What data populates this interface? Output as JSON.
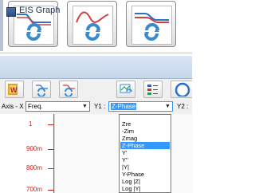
{
  "window": {
    "title": "EIS Graph"
  },
  "axis_bar": {
    "x_label": "Axis - X",
    "x_value": "Freq.",
    "y1_label": "Y1 :",
    "y1_value": "Z-Phase",
    "y2_label": "Y2 :"
  },
  "dropdown": {
    "options": [
      "Zre",
      "-Zim",
      "Zmag",
      "Z-Phase",
      "Y'",
      "Y''",
      "|Y|",
      "Y-Phase",
      "Log |Z|",
      "Log |Y|"
    ],
    "selected": "Z-Phase"
  },
  "plot": {
    "y_ticks": [
      "1",
      "900m",
      "800m",
      "700m"
    ]
  },
  "colors": {
    "accent": "#3399ff",
    "tick": "#d02020",
    "titlebar": "#c6d6ea"
  },
  "icons": {
    "big_buttons": [
      "freq-phase-graph-icon",
      "freq-sine-graph-icon",
      "freq-dual-line-graph-icon"
    ],
    "toolbar": [
      "word-export-icon",
      "graph-refresh-icon",
      "graph-refresh-icon",
      "graph-add-icon",
      "legend-icon",
      "globe-icon"
    ]
  }
}
